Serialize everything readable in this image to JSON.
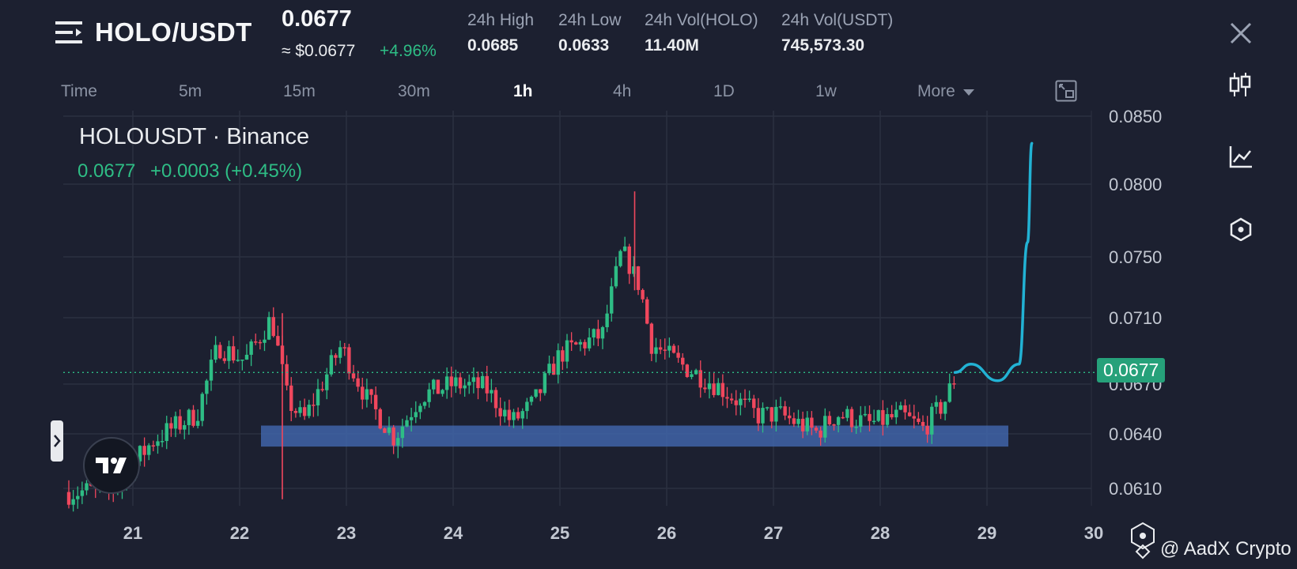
{
  "header": {
    "pair": "HOLO/USDT",
    "price": "0.0677",
    "usd_price": "≈ $0.0677",
    "change": "+4.96%",
    "stats": [
      {
        "label": "24h High",
        "value": "0.0685"
      },
      {
        "label": "24h Low",
        "value": "0.0633"
      },
      {
        "label": "24h Vol(HOLO)",
        "value": "11.40M"
      },
      {
        "label": "24h Vol(USDT)",
        "value": "745,573.30"
      }
    ]
  },
  "timeframes": {
    "items": [
      "Time",
      "5m",
      "15m",
      "30m",
      "1h",
      "4h",
      "1D",
      "1w"
    ],
    "more": "More",
    "active": "1h"
  },
  "chart_info": {
    "symbol": "HOLOUSDT · Binance",
    "last": "0.0677",
    "change": "+0.0003 (+0.45%)"
  },
  "current_price_label": "0.0677",
  "watermark": "@ AadX Crypto",
  "colors": {
    "up": "#2ebd85",
    "down": "#f0475d",
    "support_zone": "#3f64a8",
    "projection": "#22b2d4"
  },
  "icons": [
    "menu-icon",
    "close-icon",
    "candlestick-icon",
    "line-chart-icon",
    "indicator-icon",
    "fullscreen-icon",
    "expand-arrow-icon",
    "tradingview-logo-icon",
    "binance-logo-icon"
  ],
  "chart_data": {
    "type": "candlestick",
    "x_ticks": [
      "21",
      "22",
      "23",
      "24",
      "25",
      "26",
      "27",
      "28",
      "29",
      "30"
    ],
    "y_ticks": [
      "0.0850",
      "0.0800",
      "0.0750",
      "0.0710",
      "0.0670",
      "0.0640",
      "0.0610"
    ],
    "y_tick_values": [
      0.085,
      0.08,
      0.075,
      0.071,
      0.067,
      0.064,
      0.061
    ],
    "current_price": 0.0677,
    "support_zone": {
      "from": 0.0633,
      "to": 0.0645,
      "x_start": 22.2,
      "x_end": 29.2
    },
    "projection": [
      [
        28.7,
        0.0677
      ],
      [
        28.85,
        0.0682
      ],
      [
        29.1,
        0.0672
      ],
      [
        29.3,
        0.0682
      ],
      [
        29.38,
        0.076
      ],
      [
        29.42,
        0.083
      ]
    ],
    "spikes": [
      {
        "x": 22.4,
        "high": 0.0713,
        "low": 0.0604
      },
      {
        "x": 25.7,
        "high": 0.0795,
        "low": 0.0728
      }
    ],
    "price_path": [
      [
        20.4,
        0.0608
      ],
      [
        20.8,
        0.0609
      ],
      [
        21.2,
        0.0637
      ],
      [
        21.6,
        0.0652
      ],
      [
        21.8,
        0.0693
      ],
      [
        22.05,
        0.0684
      ],
      [
        22.3,
        0.071
      ],
      [
        22.45,
        0.066
      ],
      [
        22.6,
        0.0648
      ],
      [
        22.95,
        0.0693
      ],
      [
        23.2,
        0.066
      ],
      [
        23.45,
        0.0638
      ],
      [
        23.7,
        0.0663
      ],
      [
        24.0,
        0.067
      ],
      [
        24.3,
        0.0668
      ],
      [
        24.55,
        0.0647
      ],
      [
        24.75,
        0.0658
      ],
      [
        25.0,
        0.0688
      ],
      [
        25.4,
        0.07
      ],
      [
        25.58,
        0.0755
      ],
      [
        25.75,
        0.073
      ],
      [
        25.85,
        0.0695
      ],
      [
        26.1,
        0.0683
      ],
      [
        26.5,
        0.0668
      ],
      [
        26.85,
        0.0651
      ],
      [
        27.05,
        0.0652
      ],
      [
        27.4,
        0.0641
      ],
      [
        27.6,
        0.0652
      ],
      [
        27.9,
        0.0646
      ],
      [
        28.2,
        0.0651
      ],
      [
        28.4,
        0.0643
      ],
      [
        28.6,
        0.0659
      ],
      [
        28.72,
        0.0677
      ]
    ]
  }
}
